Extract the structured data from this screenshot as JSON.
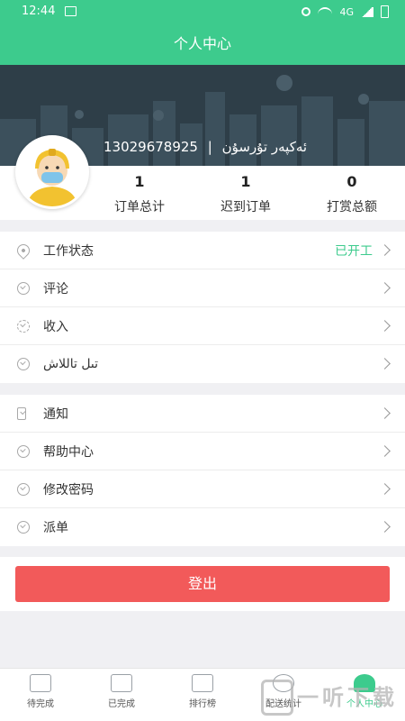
{
  "status_bar": {
    "time": "12:44",
    "network": "4G"
  },
  "header": {
    "title": "个人中心"
  },
  "profile": {
    "phone": "13029678925",
    "separator": "|",
    "name": "ئەكپەر تۇرسۇن",
    "stats": [
      {
        "value": "1",
        "label": "订单总计"
      },
      {
        "value": "1",
        "label": "迟到订单"
      },
      {
        "value": "0",
        "label": "打赏总额"
      }
    ]
  },
  "menu_group_1": [
    {
      "label": "工作状态",
      "value": "已开工",
      "icon": "location-pin-icon"
    },
    {
      "label": "评论",
      "icon": "check-circle-icon"
    },
    {
      "label": "收入",
      "icon": "gear-icon"
    },
    {
      "label": "تىل تاللاش",
      "icon": "check-circle-icon"
    }
  ],
  "menu_group_2": [
    {
      "label": "通知",
      "icon": "speaker-icon"
    },
    {
      "label": "帮助中心",
      "icon": "check-circle-icon"
    },
    {
      "label": "修改密码",
      "icon": "check-circle-icon"
    },
    {
      "label": "派单",
      "icon": "check-circle-icon"
    }
  ],
  "logout": {
    "label": "登出"
  },
  "bottom_nav": [
    {
      "label": "待完成",
      "icon": "pending-list-icon"
    },
    {
      "label": "已完成",
      "icon": "completed-list-icon"
    },
    {
      "label": "排行榜",
      "icon": "bar-chart-icon"
    },
    {
      "label": "配送统计",
      "icon": "pie-chart-icon"
    },
    {
      "label": "个人中心",
      "icon": "person-icon",
      "active": true
    }
  ],
  "watermark": {
    "text": "一听下载"
  },
  "colors": {
    "accent": "#3dcb8d",
    "danger": "#f25a5a",
    "hero": "#2e3e48"
  }
}
